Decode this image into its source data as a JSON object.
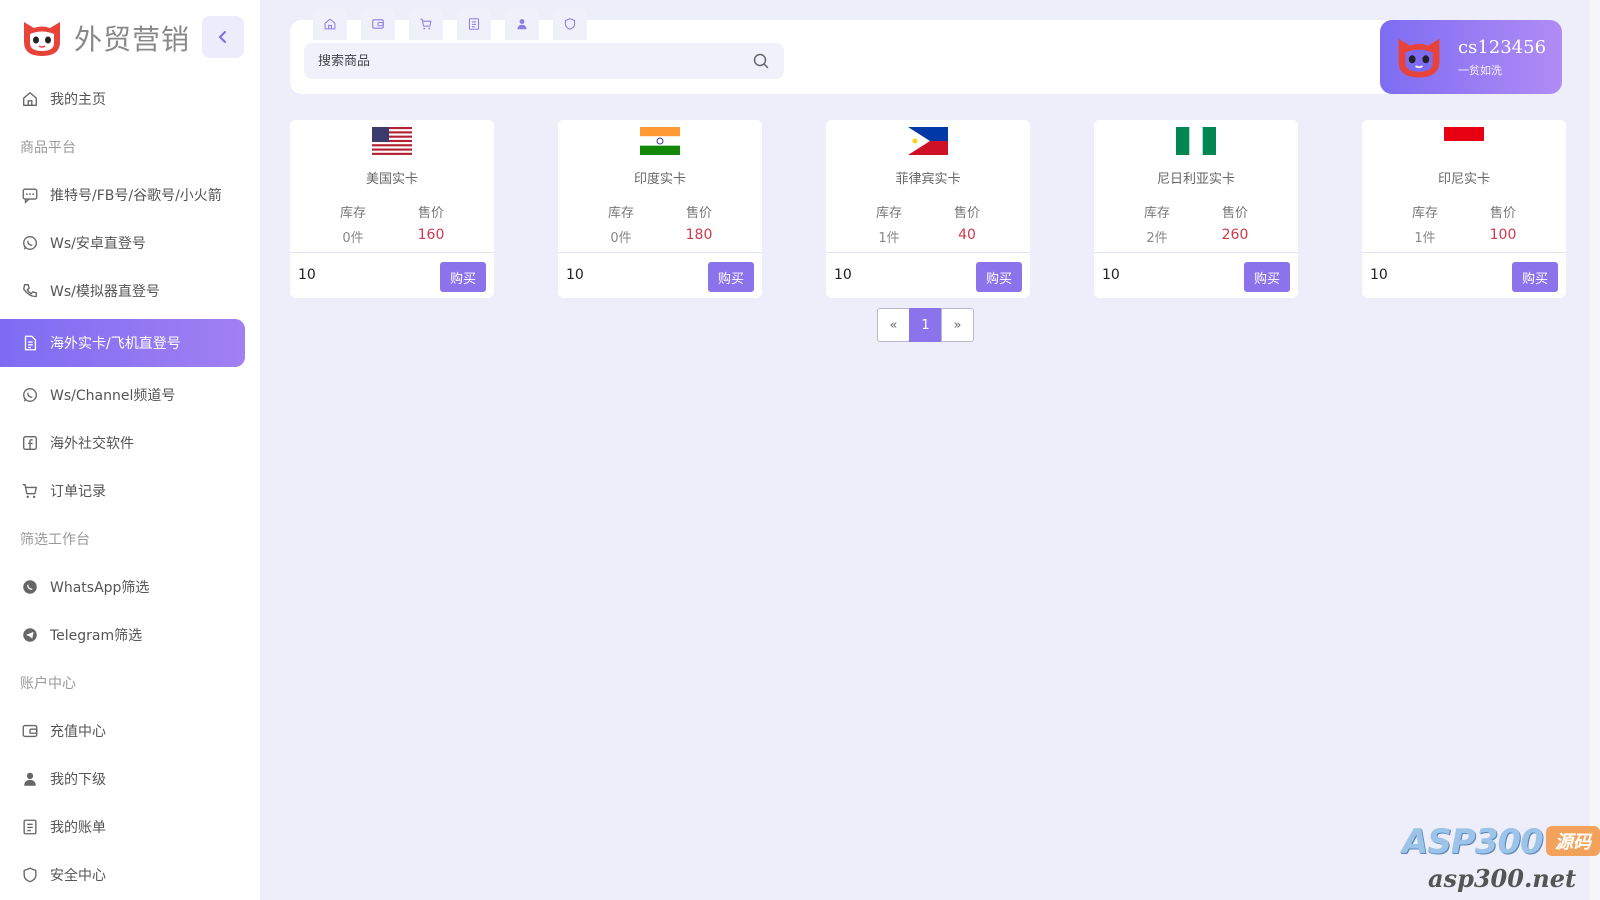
{
  "brand": {
    "name": "外贸营销"
  },
  "sidebar": {
    "items": [
      {
        "type": "item",
        "label": "我的主页",
        "icon": "home-icon"
      },
      {
        "type": "section",
        "label": "商品平台"
      },
      {
        "type": "item",
        "label": "推特号/FB号/谷歌号/小火箭",
        "icon": "message-icon"
      },
      {
        "type": "item",
        "label": "Ws/安卓直登号",
        "icon": "whatsapp-icon"
      },
      {
        "type": "item",
        "label": "Ws/模拟器直登号",
        "icon": "phone-icon"
      },
      {
        "type": "item",
        "label": "海外实卡/飞机直登号",
        "icon": "document-icon",
        "active": true
      },
      {
        "type": "item",
        "label": "Ws/Channel频道号",
        "icon": "whatsapp-icon"
      },
      {
        "type": "item",
        "label": "海外社交软件",
        "icon": "facebook-icon"
      },
      {
        "type": "item",
        "label": "订单记录",
        "icon": "cart-icon"
      },
      {
        "type": "section",
        "label": "筛选工作台"
      },
      {
        "type": "item",
        "label": "WhatsApp筛选",
        "icon": "whatsapp-filled-icon"
      },
      {
        "type": "item",
        "label": "Telegram筛选",
        "icon": "telegram-icon"
      },
      {
        "type": "section",
        "label": "账户中心"
      },
      {
        "type": "item",
        "label": "充值中心",
        "icon": "wallet-icon"
      },
      {
        "type": "item",
        "label": "我的下级",
        "icon": "user-icon"
      },
      {
        "type": "item",
        "label": "我的账单",
        "icon": "bill-icon"
      },
      {
        "type": "item",
        "label": "安全中心",
        "icon": "shield-icon"
      }
    ]
  },
  "quick_tabs": [
    "home-icon",
    "wallet-icon",
    "cart-icon",
    "bill-icon",
    "user-icon",
    "shield-icon"
  ],
  "search": {
    "placeholder": "搜索商品",
    "value": ""
  },
  "user": {
    "name": "cs123456",
    "subtitle": "一贫如洗"
  },
  "products": [
    {
      "name": "美国实卡",
      "flag": "us-flag",
      "stock_label": "库存",
      "price_label": "售价",
      "stock": "0件",
      "price": "160",
      "qty": "10",
      "buy_label": "购买"
    },
    {
      "name": "印度实卡",
      "flag": "india-flag",
      "stock_label": "库存",
      "price_label": "售价",
      "stock": "0件",
      "price": "180",
      "qty": "10",
      "buy_label": "购买"
    },
    {
      "name": "菲律宾实卡",
      "flag": "philippines-flag",
      "stock_label": "库存",
      "price_label": "售价",
      "stock": "1件",
      "price": "40",
      "qty": "10",
      "buy_label": "购买"
    },
    {
      "name": "尼日利亚实卡",
      "flag": "nigeria-flag",
      "stock_label": "库存",
      "price_label": "售价",
      "stock": "2件",
      "price": "260",
      "qty": "10",
      "buy_label": "购买"
    },
    {
      "name": "印尼实卡",
      "flag": "indonesia-flag",
      "stock_label": "库存",
      "price_label": "售价",
      "stock": "1件",
      "price": "100",
      "qty": "10",
      "buy_label": "购买"
    }
  ],
  "pagination": {
    "prev": "«",
    "current": "1",
    "next": "»"
  },
  "watermark": {
    "main": "ASP300",
    "tag": "源码",
    "url": "asp300.net"
  },
  "colors": {
    "accent": "#8b73ec",
    "price": "#d0394b",
    "background": "#eeeefb"
  }
}
